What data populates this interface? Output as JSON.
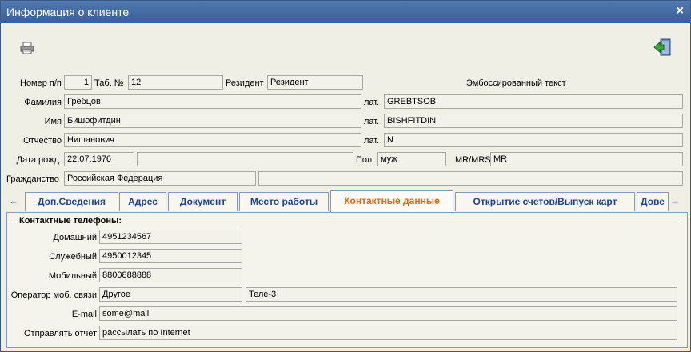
{
  "window": {
    "title": "Информация о клиенте",
    "close_glyph": "×"
  },
  "toolbar": {
    "print_icon": "printer-icon",
    "exit_icon": "exit-door-icon"
  },
  "header": {
    "num_label": "Номер п/п",
    "num_value": "1",
    "tab_label": "Таб. №",
    "tab_value": "12",
    "resident_label": "Резидент",
    "resident_value": "Резидент",
    "emboss_label": "Эмбоссированный текст",
    "lastname_label": "Фамилия",
    "lastname_value": "Гребцов",
    "lat_label": "лат.",
    "lastname_lat": "GREBTSOB",
    "firstname_label": "Имя",
    "firstname_value": "Бишофитдин",
    "firstname_lat": "BISHFITDIN",
    "patronymic_label": "Отчество",
    "patronymic_value": "Нишанович",
    "patronymic_lat": "N",
    "birth_label": "Дата рожд.",
    "birth_value": "22.07.1976",
    "birth_extra": "",
    "sex_label": "Пол",
    "sex_value": "муж",
    "mr_label": "MR/MRS",
    "mr_value": "MR",
    "citizen_label": "Гражданство",
    "citizen_value": "Российская Федерация",
    "citizen_extra": ""
  },
  "tabs": [
    {
      "label": "Доп.Сведения"
    },
    {
      "label": "Адрес"
    },
    {
      "label": "Документ"
    },
    {
      "label": "Место работы"
    },
    {
      "label": "Контактные данные"
    },
    {
      "label": "Открытие счетов/Выпуск карт"
    },
    {
      "label": "Дове"
    }
  ],
  "active_tab": "Контактные данные",
  "contacts": {
    "group_title": "Контактные телефоны:",
    "home_label": "Домашний",
    "home_value": "4951234567",
    "work_label": "Служебный",
    "work_value": "4950012345",
    "mobile_label": "Мобильный",
    "mobile_value": "8800888888",
    "operator_label": "Оператор моб. связи",
    "operator_value": "Другое",
    "operator_extra": "Теле-3",
    "email_label": "E-mail",
    "email_value": "some@mail",
    "report_label": "Отправлять отчет",
    "report_value": "рассылать по Internet"
  },
  "colors": {
    "title_bar": "#3a5f96",
    "active_tab_text": "#e06a10",
    "tab_text": "#20448a"
  }
}
